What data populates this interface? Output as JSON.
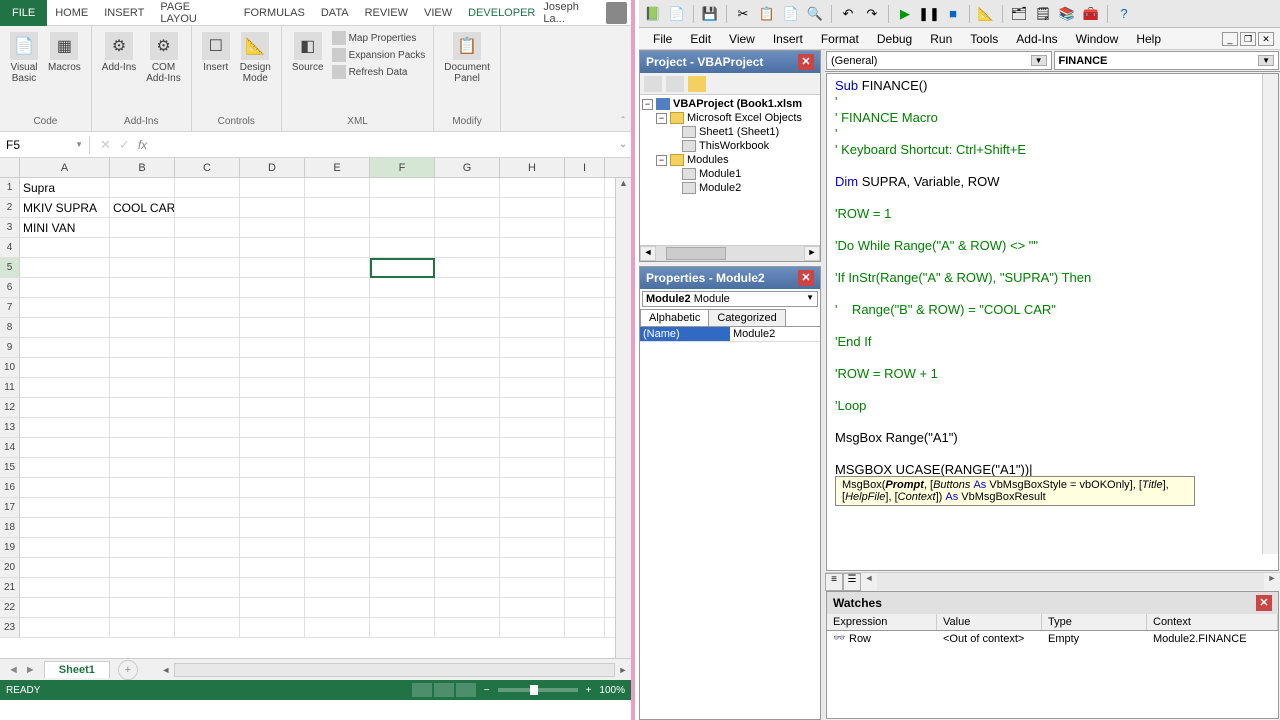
{
  "excel": {
    "file_tab": "FILE",
    "tabs": [
      "HOME",
      "INSERT",
      "PAGE LAYOU",
      "FORMULAS",
      "DATA",
      "REVIEW",
      "VIEW",
      "DEVELOPER"
    ],
    "active_tab": "DEVELOPER",
    "user": "Joseph La...",
    "ribbon": {
      "groups": {
        "code": {
          "label": "Code",
          "vb": "Visual\nBasic",
          "macros": "Macros"
        },
        "addins": {
          "label": "Add-Ins",
          "addins": "Add-Ins",
          "com": "COM\nAdd-Ins"
        },
        "controls": {
          "label": "Controls",
          "insert": "Insert",
          "design": "Design\nMode"
        },
        "xml": {
          "label": "XML",
          "source": "Source",
          "map": "Map Properties",
          "exp": "Expansion Packs",
          "refresh": "Refresh Data"
        },
        "modify": {
          "label": "Modify",
          "doc": "Document\nPanel"
        }
      }
    },
    "name_box": "F5",
    "columns": [
      "A",
      "B",
      "C",
      "D",
      "E",
      "F",
      "G",
      "H",
      "I"
    ],
    "cells": {
      "A1": "Supra",
      "A2": "MKIV SUPRA",
      "B2": "COOL CAR",
      "A3": "MINI VAN"
    },
    "selected": {
      "col": "F",
      "row": 5
    },
    "sheet_tab": "Sheet1",
    "status": "READY",
    "zoom": "100%"
  },
  "vbe": {
    "menu": [
      "File",
      "Edit",
      "View",
      "Insert",
      "Format",
      "Debug",
      "Run",
      "Tools",
      "Add-Ins",
      "Window",
      "Help"
    ],
    "project": {
      "title": "Project - VBAProject",
      "root": "VBAProject (Book1.xlsm",
      "excel_objects": "Microsoft Excel Objects",
      "sheet1": "Sheet1 (Sheet1)",
      "thiswb": "ThisWorkbook",
      "modules": "Modules",
      "mod1": "Module1",
      "mod2": "Module2"
    },
    "properties": {
      "title": "Properties - Module2",
      "object": "Module2",
      "object_type": "Module",
      "tabs": [
        "Alphabetic",
        "Categorized"
      ],
      "name_key": "(Name)",
      "name_val": "Module2"
    },
    "code": {
      "dd_left": "(General)",
      "dd_right": "FINANCE",
      "lines": [
        "Sub FINANCE()",
        "'",
        "' FINANCE Macro",
        "'",
        "' Keyboard Shortcut: Ctrl+Shift+E",
        "",
        "Dim SUPRA, Variable, ROW",
        "",
        "'ROW = 1",
        "",
        "'Do While Range(\"A\" & ROW) <> \"\"",
        "",
        "'If InStr(Range(\"A\" & ROW), \"SUPRA\") Then",
        "",
        "'    Range(\"B\" & ROW) = \"COOL CAR\"",
        "",
        "'End If",
        "",
        "'ROW = ROW + 1",
        "",
        "'Loop",
        "",
        "MsgBox Range(\"A1\")",
        "",
        "MSGBOX UCASE(RANGE(\"A1\"))|"
      ],
      "tooltip": "MsgBox(Prompt, [Buttons As VbMsgBoxStyle = vbOKOnly], [Title], [HelpFile], [Context]) As VbMsgBoxResult"
    },
    "watches": {
      "title": "Watches",
      "cols": [
        "Expression",
        "Value",
        "Type",
        "Context"
      ],
      "row": {
        "expr": "Row",
        "value": "<Out of context>",
        "type": "Empty",
        "context": "Module2.FINANCE"
      }
    }
  }
}
